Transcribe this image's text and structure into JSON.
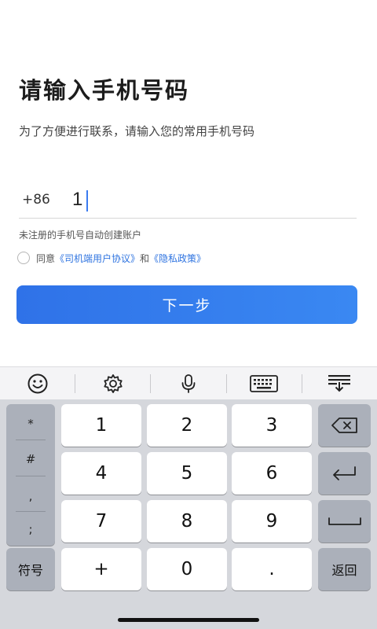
{
  "title": "请输入手机号码",
  "subtitle": "为了方便进行联系，请输入您的常用手机号码",
  "phone": {
    "country_code": "+86",
    "value": "1"
  },
  "hint": "未注册的手机号自动创建账户",
  "agreement": {
    "prefix": "同意",
    "link_driver": "《司机端用户协议》",
    "conjunction": "和",
    "link_privacy": "《隐私政策》"
  },
  "next_button": "下一步",
  "keyboard": {
    "toolbar_icons": [
      "emoji-icon",
      "gear-icon",
      "microphone-icon",
      "keyboard-icon",
      "keyboard-hide-icon"
    ],
    "symbols": [
      "*",
      "#",
      ",",
      ";"
    ],
    "digits": [
      "1",
      "2",
      "3",
      "4",
      "5",
      "6",
      "7",
      "8",
      "9",
      "0"
    ],
    "plus": "+",
    "dot": ".",
    "symbol_key": "符号",
    "return_key": "返回",
    "right_icons": [
      "backspace-icon",
      "enter-icon",
      "space-icon"
    ]
  },
  "colors": {
    "accent": "#2f74e0",
    "button_start": "#2f72e8",
    "button_end": "#3a88f2",
    "keyboard_bg": "#d5d7dc",
    "key_dark": "#abb0ba"
  }
}
